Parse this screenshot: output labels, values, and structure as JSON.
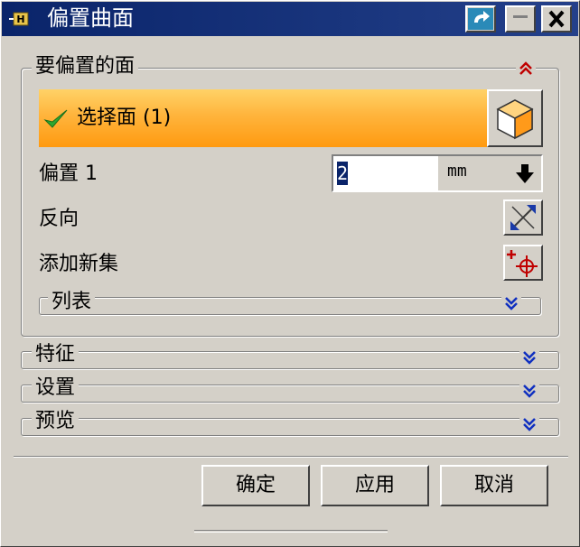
{
  "window": {
    "title": "偏置曲面"
  },
  "group_faces": {
    "title": "要偏置的面",
    "collapse_icon": "double-chevron-up-icon",
    "select_label": "选择面 (1)",
    "select_icon": "face-cube-icon",
    "offset_label": "偏置 1",
    "offset_value": "2",
    "offset_unit": "mm",
    "reverse_label": "反向",
    "add_set_label": "添加新集",
    "list_title": "列表"
  },
  "sections": [
    {
      "label": "特征"
    },
    {
      "label": "设置"
    },
    {
      "label": "预览"
    }
  ],
  "buttons": {
    "ok": "确定",
    "apply": "应用",
    "cancel": "取消"
  },
  "colors": {
    "titlebar": "#0a246a",
    "selection_bar": "#ffb43c",
    "up_chevron": "#c00000",
    "down_chevron": "#1030c0"
  }
}
